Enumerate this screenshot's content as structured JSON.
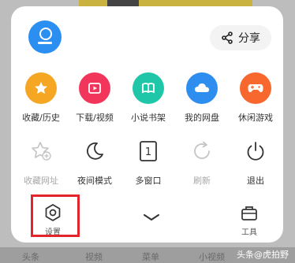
{
  "header": {
    "share_label": "分享"
  },
  "apps_row": [
    {
      "label": "收藏/历史",
      "icon": "star-icon",
      "color": "#f5a623"
    },
    {
      "label": "下载/视频",
      "icon": "video-icon",
      "color": "#f2365b"
    },
    {
      "label": "小说书架",
      "icon": "book-icon",
      "color": "#1fc7a8"
    },
    {
      "label": "我的网盘",
      "icon": "cloud-icon",
      "color": "#2d8ef0"
    },
    {
      "label": "休闲游戏",
      "icon": "gamepad-icon",
      "color": "#f8672d"
    }
  ],
  "tools_row": [
    {
      "label": "收藏网址",
      "icon": "star-add-icon",
      "disabled": true
    },
    {
      "label": "夜间模式",
      "icon": "moon-icon",
      "disabled": false
    },
    {
      "label": "多窗口",
      "icon": "window-icon",
      "badge": "1",
      "disabled": false
    },
    {
      "label": "刷新",
      "icon": "refresh-icon",
      "disabled": true
    },
    {
      "label": "退出",
      "icon": "power-icon",
      "disabled": false
    }
  ],
  "bottom": {
    "settings_label": "设置",
    "toolbox_label": "工具"
  },
  "background_nav": [
    "头条",
    "视频",
    "菜单",
    "小视频"
  ],
  "watermark": "头条@虎拍野"
}
